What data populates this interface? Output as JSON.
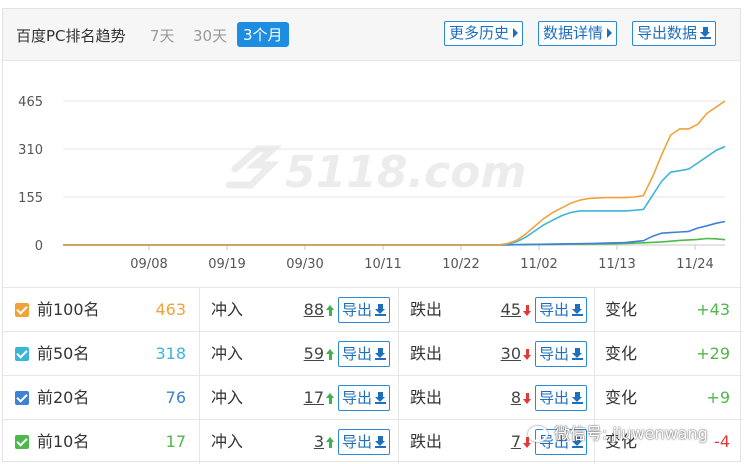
{
  "header": {
    "title": "百度PC排名趋势",
    "ranges": [
      "7天",
      "30天",
      "3个月"
    ],
    "active_range": "3个月",
    "buttons": {
      "history": "更多历史",
      "details": "数据详情",
      "export": "导出数据"
    }
  },
  "watermark_text": "5118.com",
  "chart_data": {
    "type": "line",
    "x_tick_labels": [
      "09/08",
      "09/19",
      "09/30",
      "10/11",
      "10/22",
      "11/02",
      "11/13",
      "11/24"
    ],
    "y_tick_labels": [
      "0",
      "155",
      "310",
      "465"
    ],
    "ylim": [
      0,
      465
    ],
    "grid": true,
    "series": [
      {
        "color": "#f0a33a",
        "points": [
          [
            0,
            0
          ],
          [
            48,
            0
          ],
          [
            49,
            5
          ],
          [
            50,
            15
          ],
          [
            51,
            35
          ],
          [
            52,
            60
          ],
          [
            53,
            85
          ],
          [
            54,
            105
          ],
          [
            55,
            120
          ],
          [
            56,
            135
          ],
          [
            57,
            145
          ],
          [
            58,
            150
          ],
          [
            59,
            152
          ],
          [
            60,
            153
          ],
          [
            61,
            153
          ],
          [
            62,
            153
          ],
          [
            63,
            155
          ],
          [
            64,
            160
          ],
          [
            65,
            220
          ],
          [
            66,
            290
          ],
          [
            67,
            355
          ],
          [
            68,
            375
          ],
          [
            69,
            375
          ],
          [
            70,
            390
          ],
          [
            71,
            425
          ],
          [
            72,
            445
          ],
          [
            73,
            465
          ]
        ]
      },
      {
        "color": "#3cb6d8",
        "points": [
          [
            0,
            0
          ],
          [
            48,
            0
          ],
          [
            49,
            3
          ],
          [
            50,
            10
          ],
          [
            51,
            25
          ],
          [
            52,
            45
          ],
          [
            53,
            65
          ],
          [
            54,
            80
          ],
          [
            55,
            95
          ],
          [
            56,
            105
          ],
          [
            57,
            110
          ],
          [
            58,
            110
          ],
          [
            59,
            110
          ],
          [
            60,
            110
          ],
          [
            61,
            110
          ],
          [
            62,
            110
          ],
          [
            63,
            112
          ],
          [
            64,
            115
          ],
          [
            65,
            160
          ],
          [
            66,
            205
          ],
          [
            67,
            235
          ],
          [
            68,
            240
          ],
          [
            69,
            245
          ],
          [
            70,
            265
          ],
          [
            71,
            285
          ],
          [
            72,
            305
          ],
          [
            73,
            318
          ]
        ]
      },
      {
        "color": "#3f81d4",
        "points": [
          [
            0,
            0
          ],
          [
            48,
            0
          ],
          [
            50,
            1
          ],
          [
            52,
            2
          ],
          [
            54,
            3
          ],
          [
            56,
            4
          ],
          [
            58,
            5
          ],
          [
            60,
            6
          ],
          [
            62,
            8
          ],
          [
            64,
            14
          ],
          [
            65,
            28
          ],
          [
            66,
            38
          ],
          [
            67,
            40
          ],
          [
            68,
            42
          ],
          [
            69,
            44
          ],
          [
            70,
            55
          ],
          [
            71,
            62
          ],
          [
            72,
            70
          ],
          [
            73,
            76
          ]
        ]
      },
      {
        "color": "#4fb84a",
        "points": [
          [
            0,
            0
          ],
          [
            48,
            0
          ],
          [
            50,
            1
          ],
          [
            52,
            2
          ],
          [
            54,
            2
          ],
          [
            56,
            3
          ],
          [
            58,
            3
          ],
          [
            60,
            4
          ],
          [
            62,
            5
          ],
          [
            64,
            7
          ],
          [
            66,
            10
          ],
          [
            68,
            15
          ],
          [
            70,
            18
          ],
          [
            71,
            21
          ],
          [
            72,
            20
          ],
          [
            73,
            17
          ]
        ]
      }
    ]
  },
  "rows": [
    {
      "label": "前100名",
      "check_color": "#f0a33a",
      "count": "463",
      "count_color": "#f0a33a",
      "in_label": "冲入",
      "in_value": "88",
      "out_label": "跌出",
      "out_value": "45",
      "change_label": "变化",
      "change": "+43",
      "change_color": "#4fb84a"
    },
    {
      "label": "前50名",
      "check_color": "#3cb6d8",
      "count": "318",
      "count_color": "#3cb6d8",
      "in_label": "冲入",
      "in_value": "59",
      "out_label": "跌出",
      "out_value": "30",
      "change_label": "变化",
      "change": "+29",
      "change_color": "#4fb84a"
    },
    {
      "label": "前20名",
      "check_color": "#3f81d4",
      "count": "76",
      "count_color": "#3f81d4",
      "in_label": "冲入",
      "in_value": "17",
      "out_label": "跌出",
      "out_value": "8",
      "change_label": "变化",
      "change": "+9",
      "change_color": "#4fb84a"
    },
    {
      "label": "前10名",
      "check_color": "#4fb84a",
      "count": "17",
      "count_color": "#4fb84a",
      "in_label": "冲入",
      "in_value": "3",
      "out_label": "跌出",
      "out_value": "7",
      "change_label": "变化",
      "change": "-4",
      "change_color": "#e03b3b"
    }
  ],
  "export_label": "导出",
  "overlay_watermark": "微信号: jiuwenwang"
}
